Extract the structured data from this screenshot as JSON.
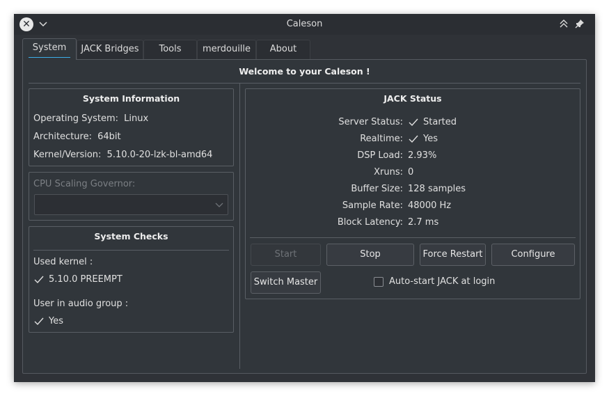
{
  "window": {
    "title": "Caleson"
  },
  "tabs": [
    "System",
    "JACK Bridges",
    "Tools",
    "merdouille",
    "About"
  ],
  "welcome": "Welcome to your Caleson !",
  "system_info": {
    "title": "System Information",
    "os_label": "Operating System:",
    "os_value": "Linux",
    "arch_label": "Architecture:",
    "arch_value": "64bit",
    "kernel_label": "Kernel/Version:",
    "kernel_value": "5.10.0-20-lzk-bl-amd64"
  },
  "cpu_governor": {
    "label": "CPU Scaling Governor:",
    "selected": ""
  },
  "system_checks": {
    "title": "System Checks",
    "kernel_label": "Used kernel :",
    "kernel_value": "5.10.0 PREEMPT",
    "audio_group_label": "User in audio group :",
    "audio_group_value": "Yes"
  },
  "jack_status": {
    "title": "JACK Status",
    "server_status_label": "Server Status:",
    "server_status_value": "Started",
    "realtime_label": "Realtime:",
    "realtime_value": "Yes",
    "dsp_label": "DSP Load:",
    "dsp_value": "2.93%",
    "xruns_label": "Xruns:",
    "xruns_value": "0",
    "buffer_label": "Buffer Size:",
    "buffer_value": "128 samples",
    "rate_label": "Sample Rate:",
    "rate_value": "48000 Hz",
    "latency_label": "Block Latency:",
    "latency_value": "2.7 ms"
  },
  "buttons": {
    "start": "Start",
    "stop": "Stop",
    "force_restart": "Force Restart",
    "configure": "Configure",
    "switch_master": "Switch Master"
  },
  "autostart": {
    "label": "Auto-start JACK at login",
    "checked": false
  },
  "colors": {
    "window_bg": "#2f3237",
    "accent": "#3daee9",
    "text": "#e0e0e0"
  }
}
